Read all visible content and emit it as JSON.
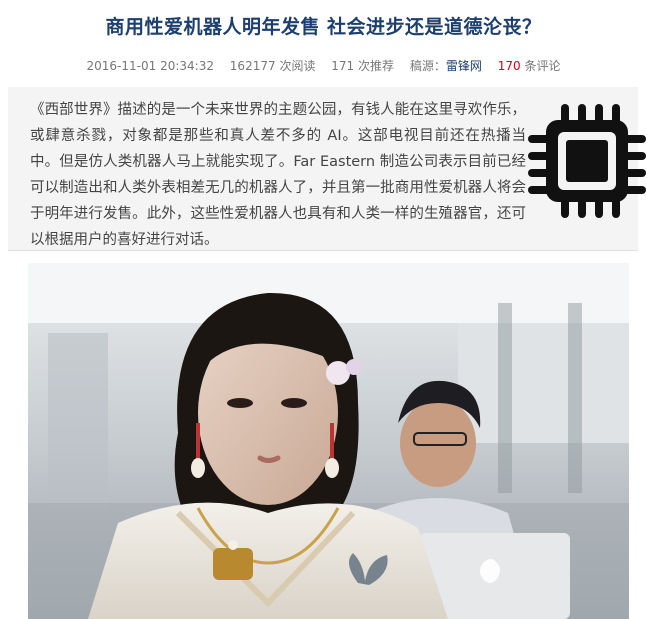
{
  "article": {
    "title": "商用性爱机器人明年发售 社会进步还是道德沦丧？",
    "meta": {
      "datetime": "2016-11-01 20:34:32",
      "views": "162177",
      "views_label": "次阅读",
      "recommends": "171",
      "recommends_label": "次推荐",
      "source_label": "稿源：",
      "source_name": "雷锋网",
      "comments": "170",
      "comments_label": "条评论"
    },
    "summary": "《西部世界》描述的是一个未来世界的主题公园，有钱人能在这里寻欢作乐，或肆意杀戮，对象都是那些和真人差不多的 AI。这部电视目前还在热播当中。但是仿人类机器人马上就能实现了。Far Eastern 制造公司表示目前已经可以制造出和人类外表相差无几的机器人了，并且第一批商用性爱机器人将会于明年进行发售。此外，这些性爱机器人也具有和人类一样的生殖器官，还可以根据用户的喜好进行对话。",
    "summary_icon": "cpu-chip-icon",
    "photo_icon": "robot-woman-photo"
  },
  "colors": {
    "title": "#1d3f6e",
    "highlight": "#d0021b",
    "summary_bg": "#f4f4f4"
  }
}
